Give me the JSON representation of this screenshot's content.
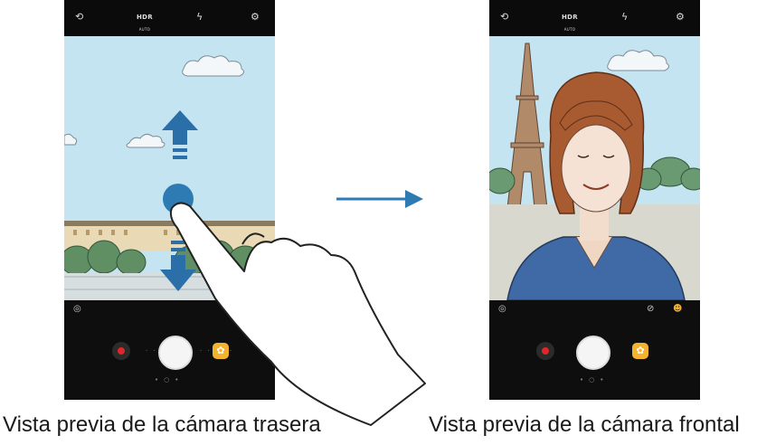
{
  "captions": {
    "rear": "Vista previa de la cámara trasera",
    "front": "Vista previa de la cámara frontal"
  },
  "camera_ui": {
    "hdr_label": "HDR",
    "hdr_sub": "AUTO",
    "icons": [
      "switch-camera-icon",
      "hdr-icon",
      "flash-off-icon",
      "settings-icon",
      "filter-icon",
      "mirror-icon",
      "animal-mask-icon"
    ]
  },
  "colors": {
    "sky": "#c4e4f2",
    "gesture_arrow": "#2a6fa8",
    "touch_point": "#2e7bb3",
    "record": "#e0262a",
    "effects": "#f3b230",
    "shirt": "#3f6aa6",
    "hair": "#a85a31"
  },
  "gesture": {
    "description_arrows": [
      "up",
      "down"
    ],
    "transition": "right"
  }
}
